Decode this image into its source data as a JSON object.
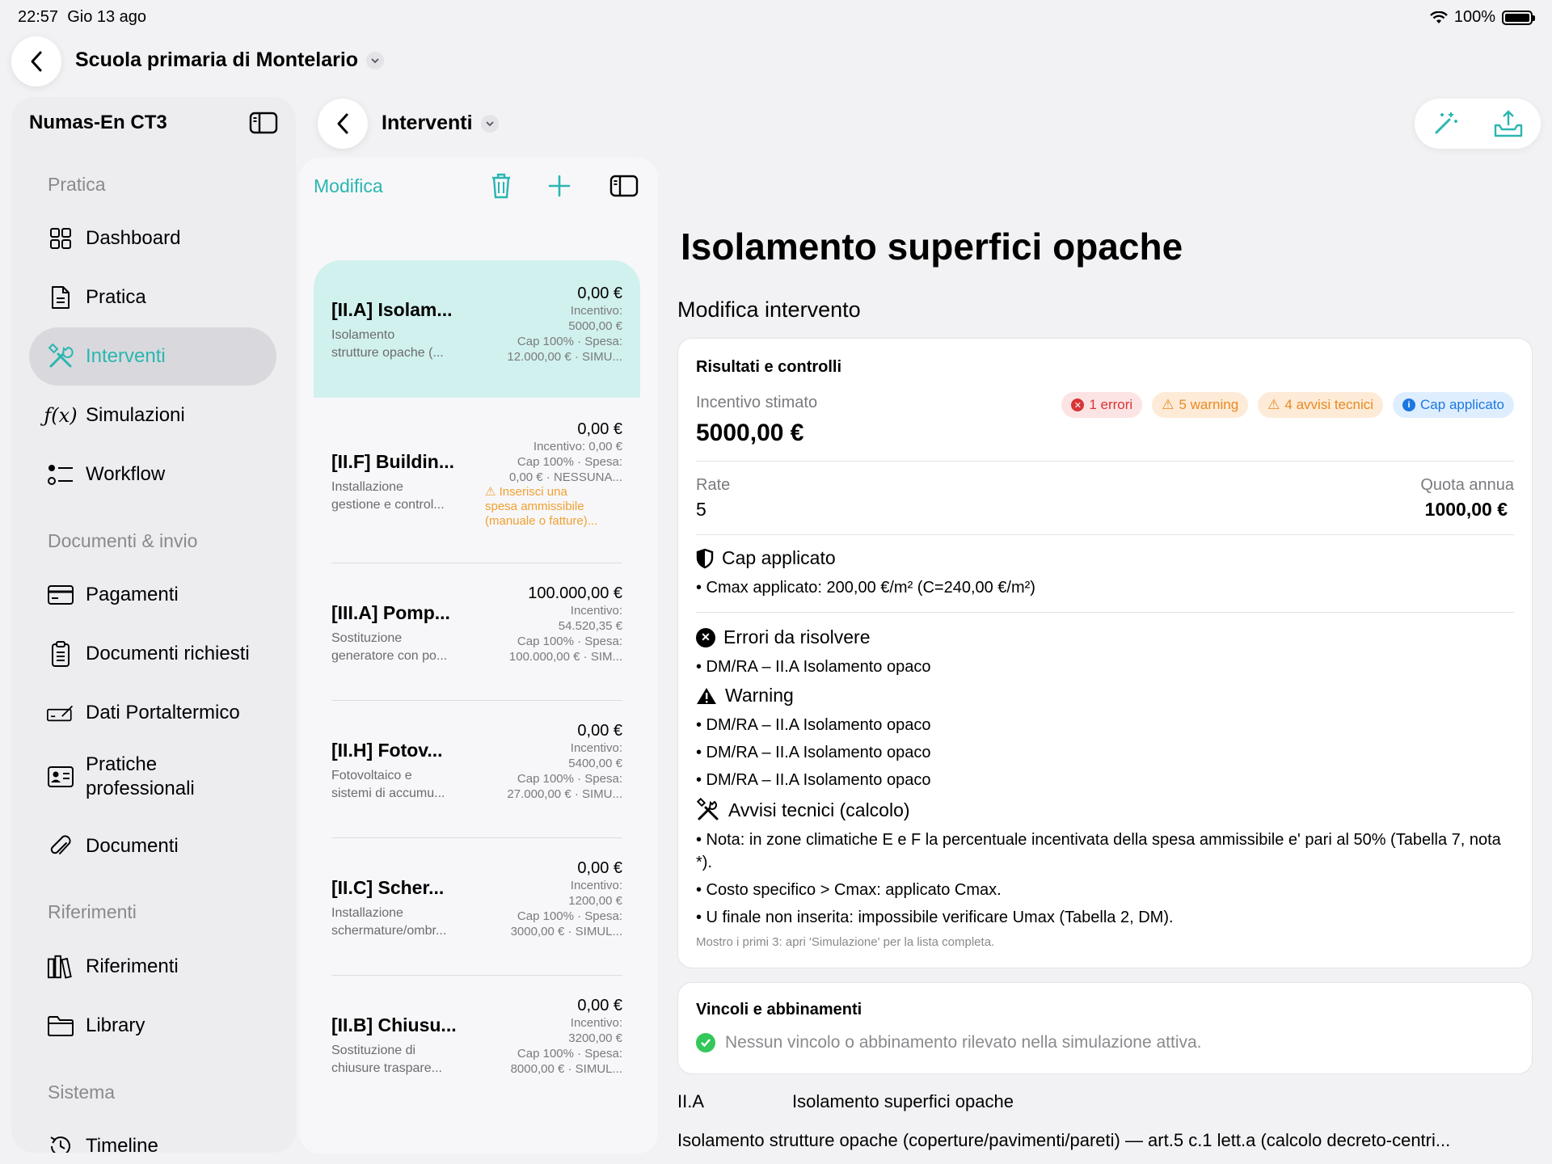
{
  "status": {
    "time": "22:57",
    "date": "Gio 13 ago",
    "battery": "100%"
  },
  "topbar": {
    "project_title": "Scuola primaria di Montelario"
  },
  "sidebar": {
    "title": "Numas-En CT3",
    "sections": [
      "Pratica",
      "Documenti & invio",
      "Riferimenti",
      "Sistema"
    ],
    "items": [
      {
        "label": "Dashboard",
        "icon": "grid-icon"
      },
      {
        "label": "Pratica",
        "icon": "document-icon"
      },
      {
        "label": "Interventi",
        "icon": "tools-icon",
        "active": true
      },
      {
        "label": "Simulazioni",
        "icon": "function-icon"
      },
      {
        "label": "Workflow",
        "icon": "workflow-icon"
      },
      {
        "label": "Pagamenti",
        "icon": "card-icon"
      },
      {
        "label": "Documenti richiesti",
        "icon": "clipboard-icon"
      },
      {
        "label": "Dati Portaltermico",
        "icon": "signature-icon"
      },
      {
        "label": "Pratiche professionali",
        "icon": "id-card-icon"
      },
      {
        "label": "Documenti",
        "icon": "paperclip-icon"
      },
      {
        "label": "Riferimenti",
        "icon": "books-icon"
      },
      {
        "label": "Library",
        "icon": "folder-icon"
      },
      {
        "label": "Timeline",
        "icon": "history-icon"
      }
    ]
  },
  "list": {
    "nav_title": "Interventi",
    "edit_label": "Modifica",
    "rows": [
      {
        "title": "[II.A] Isolam...",
        "sub1": "Isolamento",
        "sub2": "strutture opache (...",
        "amount": "0,00 €",
        "l1": "Incentivo:",
        "l2": "5000,00 €",
        "l3": "Cap 100% · Spesa:",
        "l4": "12.000,00 € · SIMU..."
      },
      {
        "title": "[II.F] Buildin...",
        "sub1": "Installazione",
        "sub2": "gestione e control...",
        "amount": "0,00 €",
        "l1": "Incentivo: 0,00 €",
        "l2": "Cap 100% · Spesa:",
        "l3": "0,00 € · NESSUNA...",
        "warn1": "Inserisci una",
        "warn2": "spesa ammissibile",
        "warn3": "(manuale o fatture)..."
      },
      {
        "title": "[III.A] Pomp...",
        "sub1": "Sostituzione",
        "sub2": "generatore con po...",
        "amount": "100.000,00 €",
        "l1": "Incentivo:",
        "l2": "54.520,35 €",
        "l3": "Cap 100% · Spesa:",
        "l4": "100.000,00 € · SIM..."
      },
      {
        "title": "[II.H] Fotov...",
        "sub1": "Fotovoltaico e",
        "sub2": "sistemi di accumu...",
        "amount": "0,00 €",
        "l1": "Incentivo:",
        "l2": "5400,00 €",
        "l3": "Cap 100% · Spesa:",
        "l4": "27.000,00 € · SIMU..."
      },
      {
        "title": "[II.C] Scher...",
        "sub1": "Installazione",
        "sub2": "schermature/ombr...",
        "amount": "0,00 €",
        "l1": "Incentivo:",
        "l2": "1200,00 €",
        "l3": "Cap 100% · Spesa:",
        "l4": "3000,00 € · SIMUL..."
      },
      {
        "title": "[II.B] Chiusu...",
        "sub1": "Sostituzione di",
        "sub2": "chiusure traspare...",
        "amount": "0,00 €",
        "l1": "Incentivo:",
        "l2": "3200,00 €",
        "l3": "Cap 100% · Spesa:",
        "l4": "8000,00 € · SIMUL..."
      }
    ]
  },
  "detail": {
    "title": "Isolamento superfici opache",
    "subtitle": "Modifica intervento",
    "results": {
      "header": "Risultati e controlli",
      "incentive_label": "Incentivo stimato",
      "incentive_value": "5000,00 €",
      "badges": {
        "errors": "1 errori",
        "warnings": "5 warning",
        "tech": "4 avvisi tecnici",
        "cap": "Cap applicato"
      },
      "rate_label": "Rate",
      "rate_value": "5",
      "quota_label": "Quota annua",
      "quota_value": "1000,00 €",
      "cap_header": "Cap applicato",
      "cap_line": "• Cmax applicato: 200,00 €/m² (C=240,00 €/m²)",
      "errors_header": "Errori da risolvere",
      "errors_line": "• DM/RA – II.A Isolamento opaco",
      "warning_header": "Warning",
      "warning_lines": [
        "• DM/RA – II.A Isolamento opaco",
        "• DM/RA – II.A Isolamento opaco",
        "• DM/RA – II.A Isolamento opaco"
      ],
      "tech_header": "Avvisi tecnici (calcolo)",
      "tech_lines": [
        "• Nota: in zone climatiche E e F la percentuale incentivata della spesa ammissibile e' pari al 50% (Tabella 7, nota *).",
        "• Costo specifico > Cmax: applicato Cmax.",
        "• U finale non inserita: impossibile verificare Umax (Tabella 2, DM)."
      ],
      "footnote": "Mostro i primi 3: apri 'Simulazione' per la lista completa."
    },
    "constraints": {
      "header": "Vincoli e abbinamenti",
      "message": "Nessun vincolo o abbinamento rilevato nella simulazione attiva."
    },
    "code": "II.A",
    "code_name": "Isolamento superfici opache",
    "description": "Isolamento strutture opache (coperture/pavimenti/pareti) — art.5 c.1 lett.a (calcolo decreto-centri..."
  },
  "colors": {
    "accent": "#2ab6b0",
    "error": "#d93535",
    "warning": "#e88a20",
    "info": "#1c78e0",
    "success": "#34c759"
  }
}
